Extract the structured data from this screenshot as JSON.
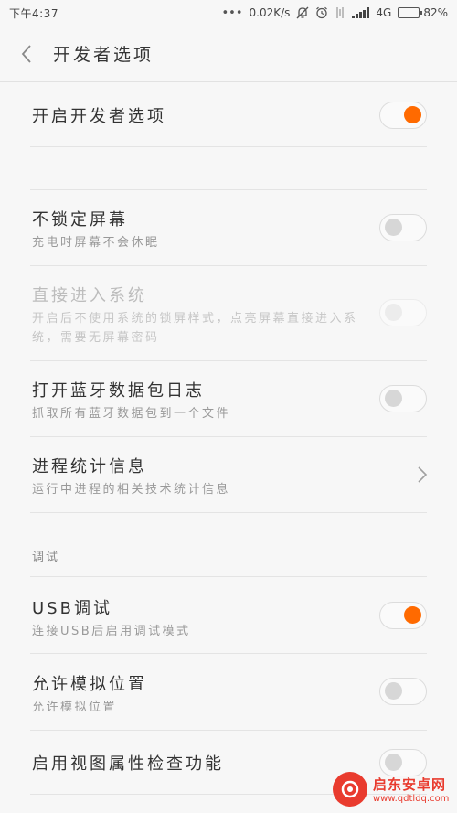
{
  "status_bar": {
    "time": "下午4:37",
    "dots": "•••",
    "speed": "0.02K/s",
    "network": "4G",
    "battery_percent": "82%",
    "battery_level": 0.82
  },
  "header": {
    "title": "开发者选项",
    "back_icon": "chevron-left-icon"
  },
  "colors": {
    "accent": "#ff6a00",
    "background": "#f7f7f7"
  },
  "settings": {
    "developer_options": {
      "label": "开启开发者选项",
      "enabled": true
    },
    "stay_awake": {
      "label": "不锁定屏幕",
      "description": "充电时屏幕不会休眠",
      "enabled": false
    },
    "direct_boot": {
      "label": "直接进入系统",
      "description": "开启后不使用系统的锁屏样式，点亮屏幕直接进入系统，需要无屏幕密码",
      "enabled": false,
      "disabled": true
    },
    "bluetooth_hci_log": {
      "label": "打开蓝牙数据包日志",
      "description": "抓取所有蓝牙数据包到一个文件",
      "enabled": false
    },
    "process_stats": {
      "label": "进程统计信息",
      "description": "运行中进程的相关技术统计信息"
    },
    "debug_section": {
      "title": "调试"
    },
    "usb_debugging": {
      "label": "USB调试",
      "description": "连接USB后启用调试模式",
      "enabled": true
    },
    "mock_location": {
      "label": "允许模拟位置",
      "description": "允许模拟位置",
      "enabled": false
    },
    "view_attribute_inspection": {
      "label": "启用视图属性检查功能",
      "enabled": false
    }
  },
  "watermark": {
    "name": "启东安卓网",
    "url": "www.qdtldq.com"
  }
}
